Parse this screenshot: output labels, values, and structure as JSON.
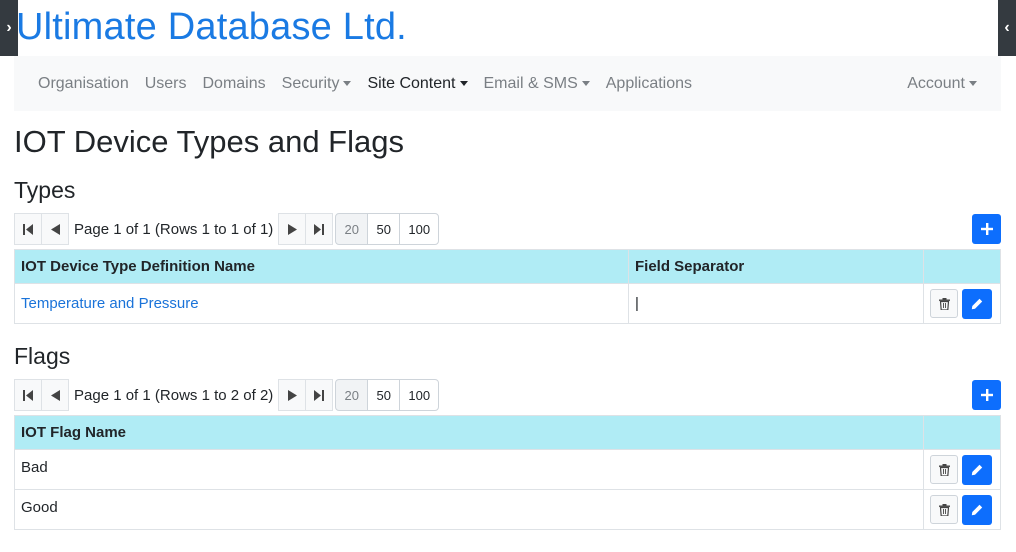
{
  "brand": "Ultimate Database Ltd.",
  "nav": {
    "items": [
      {
        "label": "Organisation",
        "dropdown": false,
        "active": false
      },
      {
        "label": "Users",
        "dropdown": false,
        "active": false
      },
      {
        "label": "Domains",
        "dropdown": false,
        "active": false
      },
      {
        "label": "Security",
        "dropdown": true,
        "active": false
      },
      {
        "label": "Site Content",
        "dropdown": true,
        "active": true
      },
      {
        "label": "Email & SMS",
        "dropdown": true,
        "active": false
      },
      {
        "label": "Applications",
        "dropdown": false,
        "active": false
      }
    ],
    "account": "Account"
  },
  "page_title": "IOT Device Types and Flags",
  "types": {
    "heading": "Types",
    "pager_text": "Page 1 of 1 (Rows 1 to 1 of 1)",
    "page_sizes": [
      "20",
      "50",
      "100"
    ],
    "columns": [
      "IOT Device Type Definition Name",
      "Field Separator"
    ],
    "rows": [
      {
        "name": "Temperature and Pressure",
        "separator": "|"
      }
    ]
  },
  "flags": {
    "heading": "Flags",
    "pager_text": "Page 1 of 1 (Rows 1 to 2 of 2)",
    "page_sizes": [
      "20",
      "50",
      "100"
    ],
    "columns": [
      "IOT Flag Name"
    ],
    "rows": [
      {
        "name": "Bad"
      },
      {
        "name": "Good"
      }
    ]
  },
  "colors": {
    "brand": "#1a7ae3",
    "primary": "#0d6efd",
    "table_header": "#b0ecf5",
    "sidebar_toggle": "#343a40"
  },
  "icons": {
    "first_page": "first-page-icon",
    "prev_page": "prev-page-icon",
    "next_page": "next-page-icon",
    "last_page": "last-page-icon",
    "add": "plus-icon",
    "delete": "trash-icon",
    "edit": "pencil-icon"
  }
}
